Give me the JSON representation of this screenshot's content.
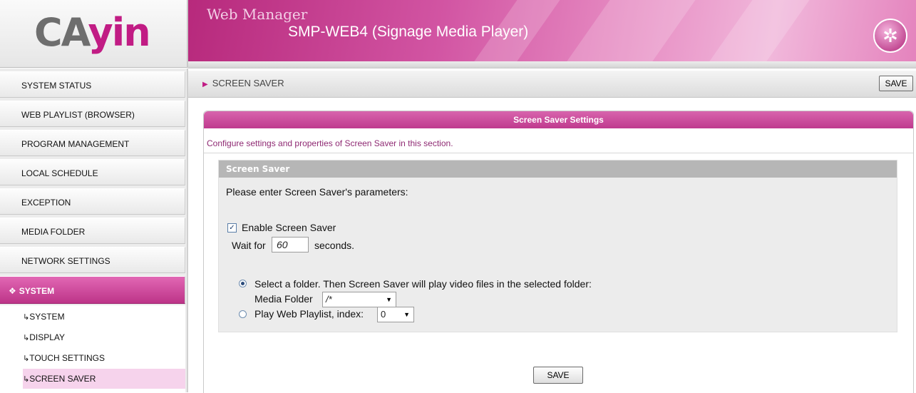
{
  "logo": {
    "part1": "CA",
    "part2": "yin"
  },
  "header": {
    "line1": "Web Manager",
    "line2": "SMP-WEB4 (Signage Media Player)",
    "icon": "wand-icon"
  },
  "sidebar": {
    "items": [
      {
        "label": "SYSTEM STATUS"
      },
      {
        "label": "WEB PLAYLIST (BROWSER)"
      },
      {
        "label": "PROGRAM MANAGEMENT"
      },
      {
        "label": "LOCAL SCHEDULE"
      },
      {
        "label": "EXCEPTION"
      },
      {
        "label": "MEDIA FOLDER"
      },
      {
        "label": "NETWORK SETTINGS"
      },
      {
        "label": "SYSTEM",
        "active": true
      }
    ],
    "sub_items": [
      {
        "label": "SYSTEM"
      },
      {
        "label": "DISPLAY"
      },
      {
        "label": "TOUCH SETTINGS"
      },
      {
        "label": "SCREEN SAVER",
        "selected": true
      }
    ]
  },
  "breadcrumb": {
    "label": "SCREEN SAVER",
    "save_label": "SAVE"
  },
  "panel": {
    "title": "Screen Saver Settings",
    "description": "Configure settings and properties of Screen Saver in this section.",
    "section_title": "Screen Saver",
    "prompt": "Please enter Screen Saver's parameters:",
    "enable_label": "Enable Screen Saver",
    "enable_checked": true,
    "wait_label": "Wait for",
    "wait_value": "60",
    "seconds_label": "seconds.",
    "option_folder_label": "Select a folder. Then Screen Saver will play video files in the selected folder:",
    "media_folder_label": "Media Folder",
    "media_folder_value": "/*",
    "option_playlist_label": "Play Web Playlist, index:",
    "playlist_index_value": "0",
    "selected_option": "folder",
    "save_label": "SAVE"
  },
  "colors": {
    "accent": "#c11c84",
    "banner": "#d255a3",
    "selected_sub": "#f6d3ec"
  }
}
